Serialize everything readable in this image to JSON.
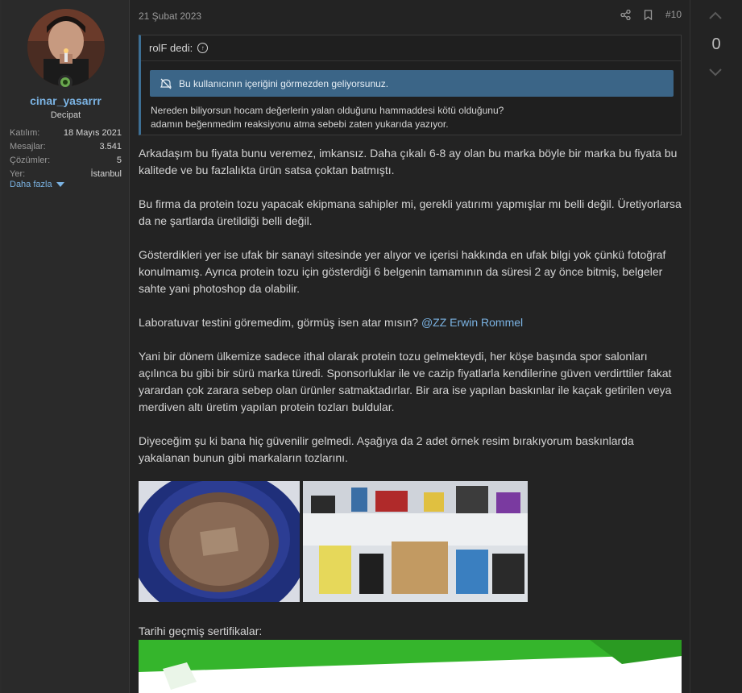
{
  "user": {
    "username": "cinar_yasarrr",
    "title": "Decipat",
    "stats": [
      {
        "label": "Katılım:",
        "value": "18 Mayıs 2021"
      },
      {
        "label": "Mesajlar:",
        "value": "3.541"
      },
      {
        "label": "Çözümler:",
        "value": "5"
      },
      {
        "label": "Yer:",
        "value": "İstanbul"
      }
    ],
    "more_label": "Daha fazla"
  },
  "post": {
    "date": "21 Şubat 2023",
    "number": "#10",
    "quote": {
      "author_line": "rolF dedi:",
      "ignored_notice": "Bu kullanıcının içeriğini görmezden geliyorsunuz.",
      "line1": "Nereden biliyorsun hocam değerlerin yalan olduğunu hammaddesi kötü olduğunu?",
      "line2": "adamın beğenmedim reaksiyonu atma sebebi zaten yukarıda yazıyor."
    },
    "paragraphs": {
      "p1": "Arkadaşım bu fiyata bunu veremez, imkansız. Daha çıkalı 6-8 ay olan bu marka böyle bir marka bu fiyata bu kalitede ve bu fazlalıkta ürün satsa çoktan batmıştı.",
      "p2": "Bu firma da protein tozu yapacak ekipmana sahipler mi, gerekli yatırımı yapmışlar mı belli değil. Üretiyorlarsa da ne şartlarda üretildiği belli değil.",
      "p3": "Gösterdikleri yer ise ufak bir sanayi sitesinde yer alıyor ve içerisi hakkında en ufak bilgi yok çünkü fotoğraf konulmamış. Ayrıca protein tozu için gösterdiği 6 belgenin tamamının da süresi 2 ay önce bitmiş, belgeler sahte yani photoshop da olabilir.",
      "p4": "Laboratuvar testini göremedim, görmüş isen atar mısın?",
      "p4_mention": "@ZZ Erwin Rommel",
      "p5": "Yani bir dönem ülkemize sadece ithal olarak protein tozu gelmekteydi, her köşe başında spor salonları açılınca bu gibi bir sürü marka türedi. Sponsorluklar ile ve cazip fiyatlarla kendilerine güven verdirttiler fakat yarardan çok zarara sebep olan ürünler satmaktadırlar. Bir ara ise yapılan baskınlar ile kaçak getirilen veya merdiven altı üretim yapılan protein tozları buldular.",
      "p6": "Diyeceğim şu ki bana hiç güvenilir gelmedi. Aşağıya da 2 adet örnek resim bırakıyorum baskınlarda yakalanan bunun gibi markaların tozlarını."
    },
    "cert_label": "Tarihi geçmiş sertifikalar:"
  },
  "vote": {
    "count": "0"
  },
  "colors": {
    "link": "#7bb3e3",
    "notice_bg": "#3b6587",
    "online": "#6aa84f"
  }
}
